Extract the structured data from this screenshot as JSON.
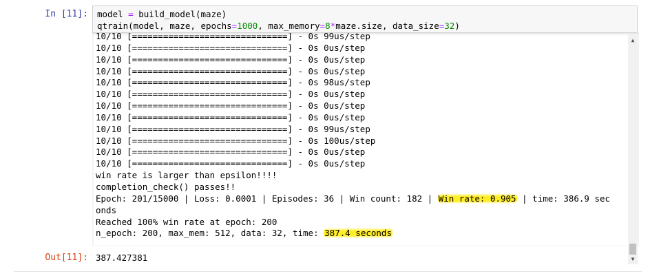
{
  "cell": {
    "in_prompt": "In [11]:",
    "out_prompt": "Out[11]:",
    "code": [
      [
        {
          "t": "model "
        },
        {
          "t": "=",
          "c": "op"
        },
        {
          "t": " build_model(maze)"
        }
      ],
      [
        {
          "t": "qtrain(model, maze, epochs"
        },
        {
          "t": "=",
          "c": "op"
        },
        {
          "t": "1000",
          "c": "num"
        },
        {
          "t": ", max_memory"
        },
        {
          "t": "=",
          "c": "op"
        },
        {
          "t": "8",
          "c": "num"
        },
        {
          "t": "*",
          "c": "op"
        },
        {
          "t": "maze.size, data_size"
        },
        {
          "t": "=",
          "c": "op"
        },
        {
          "t": "32",
          "c": "num"
        },
        {
          "t": ")"
        }
      ]
    ],
    "output": [
      [
        {
          "t": "10/10 [==============================] - 0s 99us/step"
        }
      ],
      [
        {
          "t": "10/10 [==============================] - 0s 0us/step"
        }
      ],
      [
        {
          "t": "10/10 [==============================] - 0s 0us/step"
        }
      ],
      [
        {
          "t": "10/10 [==============================] - 0s 0us/step"
        }
      ],
      [
        {
          "t": "10/10 [==============================] - 0s 98us/step"
        }
      ],
      [
        {
          "t": "10/10 [==============================] - 0s 0us/step"
        }
      ],
      [
        {
          "t": "10/10 [==============================] - 0s 0us/step"
        }
      ],
      [
        {
          "t": "10/10 [==============================] - 0s 0us/step"
        }
      ],
      [
        {
          "t": "10/10 [==============================] - 0s 99us/step"
        }
      ],
      [
        {
          "t": "10/10 [==============================] - 0s 100us/step"
        }
      ],
      [
        {
          "t": "10/10 [==============================] - 0s 0us/step"
        }
      ],
      [
        {
          "t": "10/10 [==============================] - 0s 0us/step"
        }
      ],
      [
        {
          "t": "win rate is larger than epsilon!!!!"
        }
      ],
      [
        {
          "t": "completion_check() passes!!"
        }
      ],
      [
        {
          "t": "Epoch: 201/15000 | Loss: 0.0001 | Episodes: 36 | Win count: 182 | "
        },
        {
          "t": "Win rate: 0.905",
          "hl": true
        },
        {
          "t": " | time: 386.9 sec"
        }
      ],
      [
        {
          "t": "onds"
        }
      ],
      [
        {
          "t": "Reached 100% win rate at epoch: 200"
        }
      ],
      [
        {
          "t": "n_epoch: 200, max_mem: 512, data: 32, time: "
        },
        {
          "t": "387.4 seconds",
          "hl": true
        }
      ]
    ],
    "result": "387.427381"
  },
  "colors": {
    "in_prompt": "#303f9f",
    "out_prompt": "#d84315",
    "highlight": "#ffeb00",
    "operator": "#aa22ff",
    "number": "#008800"
  }
}
